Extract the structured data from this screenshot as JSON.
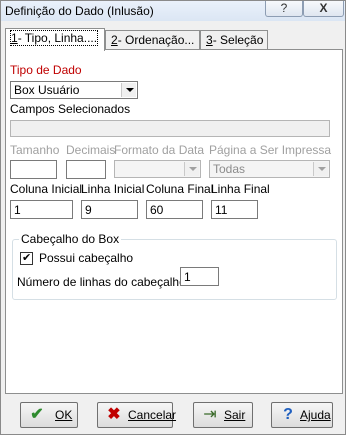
{
  "window": {
    "title": "Definição do Dado (Inlusão)",
    "help_glyph": "?",
    "close_glyph": "X"
  },
  "tabs": [
    {
      "key": "1",
      "label": "- Tipo, Linha....",
      "active": true
    },
    {
      "key": "2",
      "label": "- Ordenação...",
      "active": false
    },
    {
      "key": "3",
      "label": "- Seleção",
      "active": false
    }
  ],
  "form": {
    "tipo_dado_label": "Tipo de Dado",
    "tipo_dado_value": "Box Usuário",
    "campos_label": "Campos Selecionados",
    "campos_value": "",
    "tamanho_label": "Tamanho",
    "tamanho_value": "",
    "decimais_label": "Decimais",
    "decimais_value": "",
    "formato_data_label": "Formato da Data",
    "formato_data_value": "",
    "pagina_label": "Página a Ser Impressa",
    "pagina_value": "Todas",
    "coluna_inicial_label": "Coluna Inicial",
    "coluna_inicial_value": "1",
    "linha_inicial_label": "Linha Inicial",
    "linha_inicial_value": "9",
    "coluna_final_label": "Coluna Final",
    "coluna_final_value": "60",
    "linha_final_label": "Linha Final",
    "linha_final_value": "11"
  },
  "cabecalho": {
    "group_title": "Cabeçalho do Box",
    "possui_label": "Possui cabeçalho",
    "possui_checked": true,
    "num_linhas_label": "Número de linhas do cabeçalho",
    "num_linhas_value": "1"
  },
  "buttons": {
    "ok": "OK",
    "cancelar": "Cancelar",
    "sair": "Sair",
    "ajuda": "Ajuda"
  },
  "colors": {
    "required_label": "#c00000",
    "ok_icon": "#2e8b2e",
    "cancel_icon": "#c00000",
    "help_icon": "#1f5fbf"
  },
  "icons": [
    "help-icon",
    "close-icon",
    "check-icon",
    "x-icon",
    "exit-icon",
    "question-icon"
  ]
}
